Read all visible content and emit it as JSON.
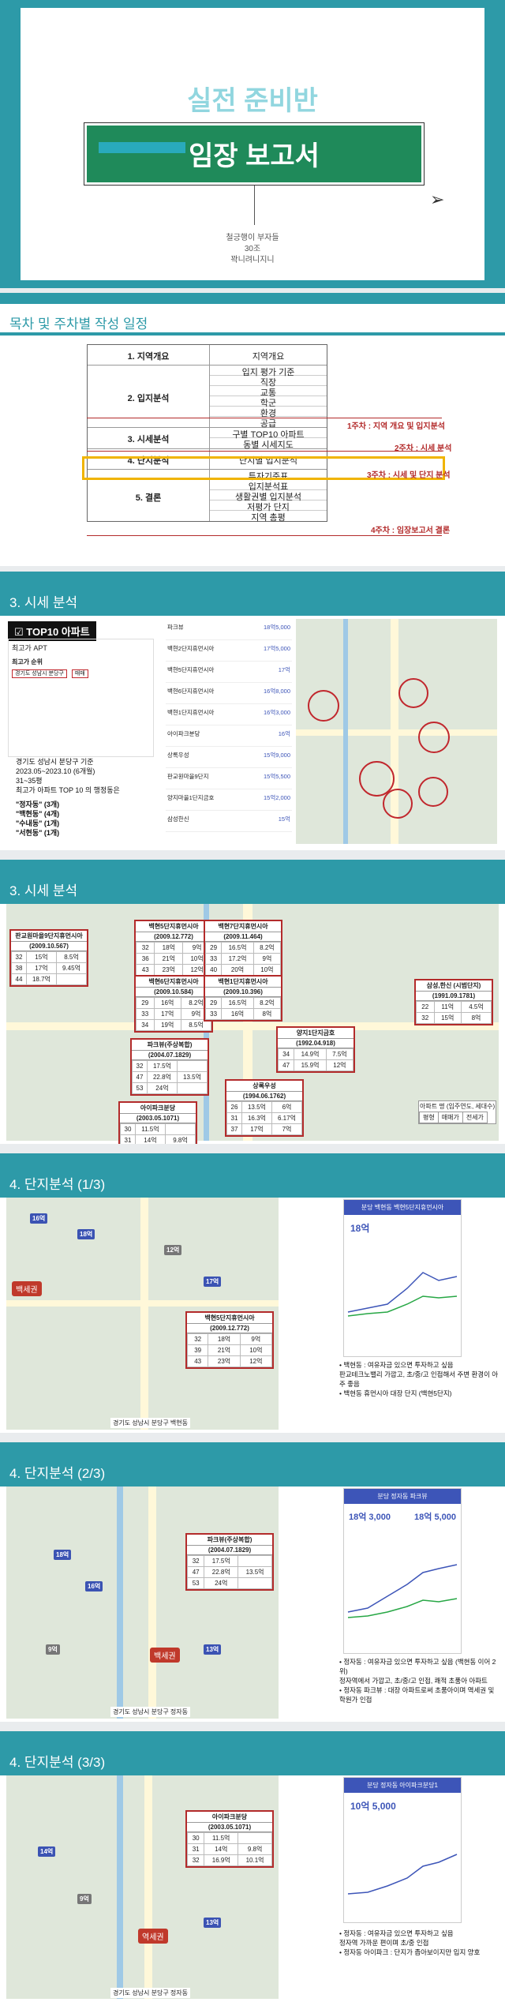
{
  "cover": {
    "title_top": "실전 준비반",
    "title_main": "임장 보고서",
    "team": "철긍행이 부자들",
    "cohort": "30조",
    "author": "꽉니려니지니"
  },
  "toc": {
    "heading": "목차 및 주차별 작성 일정",
    "rows": [
      {
        "num": "1. 지역개요",
        "items": [
          "지역개요"
        ]
      },
      {
        "num": "2. 입지분석",
        "items": [
          "입지 평가 기준",
          "직장",
          "교통",
          "학군",
          "환경",
          "공급"
        ]
      },
      {
        "num": "3. 시세분석",
        "items": [
          "구별 TOP10 아파트",
          "동별 시세지도"
        ]
      },
      {
        "num": "4. 단지분석",
        "items": [
          "단지별 입지분석"
        ]
      },
      {
        "num": "5. 결론",
        "items": [
          "투자기준표",
          "입지분석표",
          "생활권별 입지분석",
          "저평가 단지",
          "지역 총평"
        ]
      }
    ],
    "weeks": [
      "1주차 : 지역 개요 및 입지분석",
      "2주차 : 시세 분석",
      "3주차 : 시세 및 단지 분석",
      "4주차 : 임장보고서 결론"
    ]
  },
  "s3a": {
    "heading": "3. 시세 분석",
    "badge": "TOP10 아파트",
    "app_title": "최고가 APT",
    "sub": "최고가 순위",
    "filter1": "분당구",
    "filter2": "경기도 성남시 분당구",
    "filter3": "매매",
    "note_lines": [
      "경기도 성남시 분당구 기준",
      "2023.05~2023.10 (6개월)",
      "31~35평",
      "최고가 아파트 TOP 10 의 행정동은"
    ],
    "dong_lines": [
      "\"정자동\" (3개)",
      "\"백현동\" (4개)",
      "\"수내동\" (1개)",
      "\"서현동\" (1개)"
    ],
    "list": [
      "파크뷰",
      "백현2단지휴먼시아",
      "백현5단지휴먼시아",
      "백현6단지휴먼시아",
      "백현1단지휴먼시아",
      "아이파크분당",
      "상록우성",
      "판교원마을9단지",
      "양지마을1단지금호",
      "삼성한신"
    ],
    "prices": [
      "18억5,000",
      "17억5,000",
      "17억",
      "16억8,000",
      "16억3,000",
      "16억",
      "15억9,000",
      "15억5,500",
      "15억2,000",
      "15억"
    ]
  },
  "s3b": {
    "heading": "3. 시세 분석",
    "legend": {
      "h": [
        "평형",
        "매매가",
        "전세가"
      ]
    },
    "complexes": [
      {
        "name": "판교원마을9단지휴먼시아",
        "year": "(2009.10.567)",
        "rows": [
          [
            "32",
            "15억",
            "8.5억"
          ],
          [
            "38",
            "17억",
            "9.45억"
          ],
          [
            "44",
            "18.7억",
            ""
          ]
        ]
      },
      {
        "name": "백현5단지휴먼시아",
        "year": "(2009.12.772)",
        "rows": [
          [
            "32",
            "18억",
            "9억"
          ],
          [
            "36",
            "21억",
            "10억"
          ],
          [
            "43",
            "23억",
            "12억"
          ]
        ]
      },
      {
        "name": "백현7단지휴먼시아",
        "year": "(2009.11.464)",
        "rows": [
          [
            "29",
            "16.5억",
            "8.2억"
          ],
          [
            "33",
            "17.2억",
            "9억"
          ],
          [
            "40",
            "20억",
            "10억"
          ]
        ]
      },
      {
        "name": "백현6단지휴먼시아",
        "year": "(2009.10.584)",
        "rows": [
          [
            "29",
            "16억",
            "8.2억"
          ],
          [
            "33",
            "17억",
            "9억"
          ],
          [
            "34",
            "19억",
            "8.5억"
          ]
        ]
      },
      {
        "name": "백현1단지휴먼시아",
        "year": "(2009.10.396)",
        "rows": [
          [
            "29",
            "16.5억",
            "8.2억"
          ],
          [
            "33",
            "16억",
            "8억"
          ]
        ]
      },
      {
        "name": "삼성,한신 (시범단지)",
        "year": "(1991.09.1781)",
        "rows": [
          [
            "22",
            "11억",
            "4.5억"
          ],
          [
            "32",
            "15억",
            "8억"
          ]
        ]
      },
      {
        "name": "파크뷰(주상복합)",
        "year": "(2004.07.1829)",
        "rows": [
          [
            "32",
            "17.5억",
            ""
          ],
          [
            "47",
            "22.8억",
            "13.5억"
          ],
          [
            "53",
            "24억",
            ""
          ]
        ]
      },
      {
        "name": "양지1단지금호",
        "year": "(1992.04.918)",
        "rows": [
          [
            "34",
            "14.9억",
            "7.5억"
          ],
          [
            "47",
            "15.9억",
            "12억"
          ]
        ]
      },
      {
        "name": "상록우성",
        "year": "(1994.06.1762)",
        "rows": [
          [
            "26",
            "13.5억",
            "6억"
          ],
          [
            "31",
            "16.3억",
            "6.17억"
          ],
          [
            "37",
            "17억",
            "7억"
          ]
        ]
      },
      {
        "name": "아이파크분당",
        "year": "(2003.05.1071)",
        "rows": [
          [
            "30",
            "11.5억",
            ""
          ],
          [
            "31",
            "14억",
            "9.8억"
          ],
          [
            "32",
            "16.9억",
            "10.1억"
          ]
        ]
      }
    ],
    "legend_title": "아파트 명 (입주연도, 세대수)"
  },
  "s4a": {
    "heading": "4. 단지분석 (1/3)",
    "table": {
      "name": "백현5단지휴먼시아",
      "year": "(2009.12.772)",
      "rows": [
        [
          "32",
          "18억",
          "9억"
        ],
        [
          "39",
          "21억",
          "10억"
        ],
        [
          "43",
          "23억",
          "12억"
        ]
      ]
    },
    "station": "백세권",
    "phone_title": "분당 백현동 백현5단지휴먼시아",
    "phone_price": "18억",
    "footer": "경기도 성남시 분당구 백현동",
    "notes": [
      "• 백현동 : 여유자금 있으면 투자하고 싶음",
      "판교테크노밸리 가깝고, 초/중/고 인접해서 주변 환경이 아주 좋음",
      "• 백현동 휴먼시아 대장 단지 (백현5단지)"
    ]
  },
  "s4b": {
    "heading": "4. 단지분석 (2/3)",
    "table": {
      "name": "파크뷰(주상복합)",
      "year": "(2004.07.1829)",
      "rows": [
        [
          "32",
          "17.5억",
          ""
        ],
        [
          "47",
          "22.8억",
          "13.5억"
        ],
        [
          "53",
          "24억",
          ""
        ]
      ]
    },
    "station": "백세권",
    "phone_title": "분당 정자동 파크뷰",
    "price_a": "18억 3,000",
    "price_b": "18억 5,000",
    "footer": "경기도 성남시 분당구 정자동",
    "notes": [
      "• 정자동 : 여유자금 있으면 투자하고 싶음 (백현동 이어 2위)",
      "정자역에서 가깝고, 초/중/고 인접, 쾌적 초품아 아파트",
      "• 정자동 파크뷰 : 대장 아파트로써 초품아이며 역세권 및 학원가 인접"
    ]
  },
  "s4c": {
    "heading": "4. 단지분석 (3/3)",
    "table": {
      "name": "아이파크분당",
      "year": "(2003.05.1071)",
      "rows": [
        [
          "30",
          "11.5억",
          ""
        ],
        [
          "31",
          "14억",
          "9.8억"
        ],
        [
          "32",
          "16.9억",
          "10.1억"
        ]
      ]
    },
    "station": "역세권",
    "phone_title": "분당 정자동 아이파크분당1",
    "phone_price": "10억 5,000",
    "footer": "경기도 성남시 분당구 정자동",
    "notes": [
      "• 정자동 : 여유자금 있으면 투자하고 싶음",
      "정자역 가까운 편이며 초/중 인접",
      "• 정자동 아이파크 : 단지가 좁아보이지만 입지 양호"
    ]
  },
  "colors": {
    "teal": "#2d9aa8",
    "green": "#1f8a5a",
    "red": "#c1272d",
    "blue": "#3b53b3"
  }
}
